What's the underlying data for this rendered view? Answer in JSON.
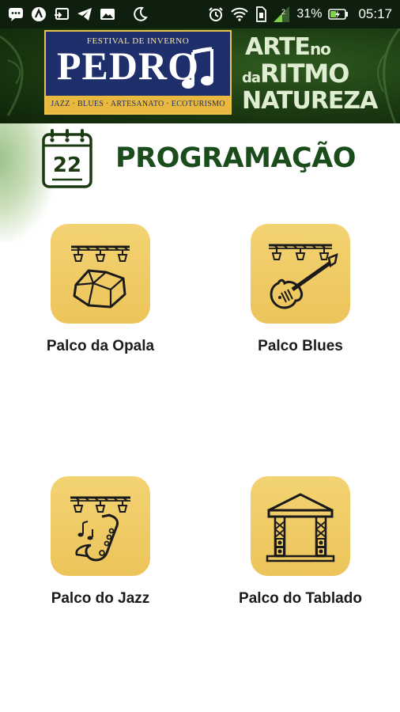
{
  "status_bar": {
    "battery": "31%",
    "time": "05:17",
    "signal_network": "2",
    "icons": [
      "chat-icon",
      "app-a-icon",
      "cast-icon",
      "telegram-icon",
      "gallery-icon",
      "moon-icon",
      "alarm-icon",
      "wifi-icon",
      "sim-icon",
      "signal-icon",
      "battery-charging-icon"
    ]
  },
  "header": {
    "logo_top": "FESTIVAL DE INVERNO",
    "logo_main": "PEDRO",
    "logo_band": "JAZZ · BLUES · ARTESANATO · ECOTURISMO",
    "slogan": {
      "arte": "ARTE",
      "no": "no",
      "da": "da",
      "ritmo": "RITMO",
      "natureza": "NATUREZA"
    }
  },
  "title": {
    "calendar_day": "22",
    "text": "PROGRAMAÇÃO"
  },
  "stages": [
    {
      "label": "Palco da Opala",
      "icon": "opal-stage-icon"
    },
    {
      "label": "Palco Blues",
      "icon": "guitar-stage-icon"
    },
    {
      "label": "Palco do Jazz",
      "icon": "saxophone-stage-icon"
    },
    {
      "label": "Palco do Tablado",
      "icon": "tablado-stage-icon"
    }
  ],
  "colors": {
    "header_green": "#1b3a12",
    "tile_gold": "#f0cb63",
    "title_green": "#1b4d1c",
    "logo_blue": "#1f2f6b"
  }
}
